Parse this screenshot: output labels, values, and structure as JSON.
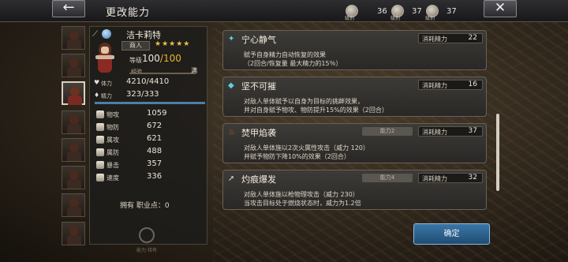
{
  "header": {
    "title": "更改能力",
    "back_label": "←",
    "close_label": "✕",
    "resources": [
      {
        "icon": "silver-orb-icon",
        "level": "级别",
        "value": "36"
      },
      {
        "icon": "gem-cluster-icon",
        "level": "级别",
        "value": "37"
      },
      {
        "icon": "star-gem-icon",
        "level": "级别",
        "value": "37"
      }
    ]
  },
  "character": {
    "name": "洁卡莉特",
    "job": "商人",
    "stars": "★★★★★",
    "level_label": "等级",
    "level": "100",
    "level_max": "/100",
    "exp_label": "经验",
    "exp_max_label": "满",
    "hp_label": "体力",
    "hp": "4210/4410",
    "mp_label": "精力",
    "mp": "323/333",
    "stats": [
      {
        "label": "物攻",
        "value": "1059"
      },
      {
        "label": "物防",
        "value": "672"
      },
      {
        "label": "属攻",
        "value": "621"
      },
      {
        "label": "属防",
        "value": "488"
      },
      {
        "label": "暴击",
        "value": "357"
      },
      {
        "label": "速度",
        "value": "336"
      }
    ],
    "job_points": "拥有 职业点：0",
    "emblem_text": "能力·持有"
  },
  "skills": [
    {
      "icon": "✦",
      "icon_color": "#5fd0e6",
      "name": "宁心静气",
      "cost_label": "消耗精力",
      "cost": "22",
      "req": "",
      "desc1": "赋予自身精力自动恢复的效果",
      "desc2": "（2回合/恢复量 最大精力的15％）"
    },
    {
      "icon": "◆",
      "icon_color": "#5fd0e6",
      "name": "坚不可摧",
      "cost_label": "消耗精力",
      "cost": "16",
      "req": "",
      "desc1": "对敌人单体赋予以自身为目标的挑衅效果，",
      "desc2": "并对自身赋予物攻、物防提升15%的效果（2回合）"
    },
    {
      "icon": "♨",
      "icon_color": "#e2553a",
      "name": "焚甲焰袭",
      "cost_label": "消耗精力",
      "cost": "37",
      "req": "能力2",
      "desc1": "对敌人单体施以2次火属性攻击（威力 120）",
      "desc2": "并赋予物防下降10%的效果（2回合）"
    },
    {
      "icon": "➚",
      "icon_color": "#e6e0d2",
      "name": "灼痕爆发",
      "cost_label": "消耗精力",
      "cost": "32",
      "req": "能力4",
      "desc1": "对敌人单体施以枪物理攻击（威力 230）",
      "desc2": "当攻击目标处于燃烧状态时，威力为1.2倍"
    }
  ],
  "confirm_label": "确定"
}
